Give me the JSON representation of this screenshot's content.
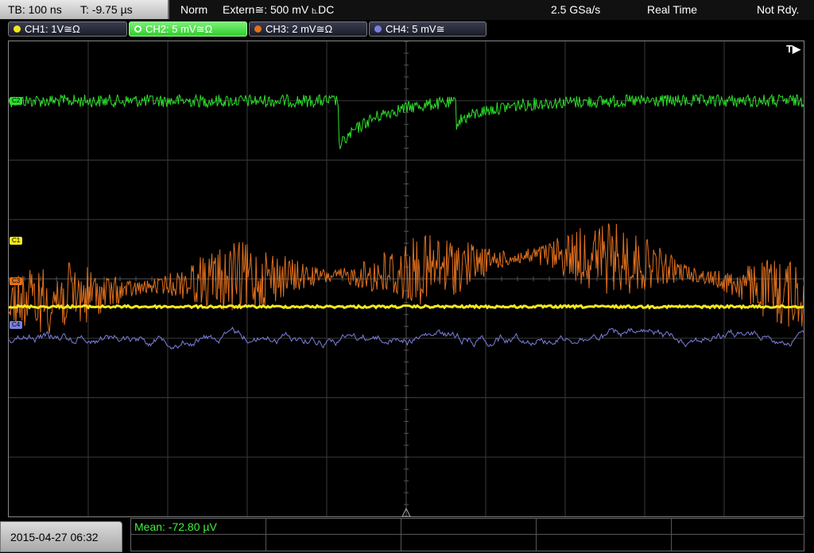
{
  "colors": {
    "ch1": "#f2e81c",
    "ch2": "#2be02a",
    "ch3": "#e0701e",
    "ch4": "#7b7fdc",
    "grid": "#3a3a3a",
    "measure_green": "#3ff23a"
  },
  "header": {
    "timebase": "TB: 100 ns",
    "trigger_time": "T: -9.75 µs",
    "trigger_mode": "Norm",
    "trigger_source": "Extern≅: 500 mV ⦜DC",
    "sample_rate": "2.5 GSa/s",
    "acq_mode": "Real Time",
    "status": "Not Rdy."
  },
  "channels": [
    {
      "label": "CH1: 1V≅Ω",
      "color": "#f2e81c",
      "marker": "C1",
      "active": false
    },
    {
      "label": "CH2: 5 mV≅Ω",
      "color": "#2be02a",
      "marker": "C2",
      "active": true
    },
    {
      "label": "CH3: 2 mV≅Ω",
      "color": "#e0701e",
      "marker": "C3",
      "active": false
    },
    {
      "label": "CH4: 5 mV≅",
      "color": "#7b7fdc",
      "marker": "C4",
      "active": false
    }
  ],
  "plot": {
    "trigger_flag": "T▶"
  },
  "footer": {
    "datetime": "2015-04-27 06:32",
    "measurement": "Mean: -72.80 µV"
  }
}
